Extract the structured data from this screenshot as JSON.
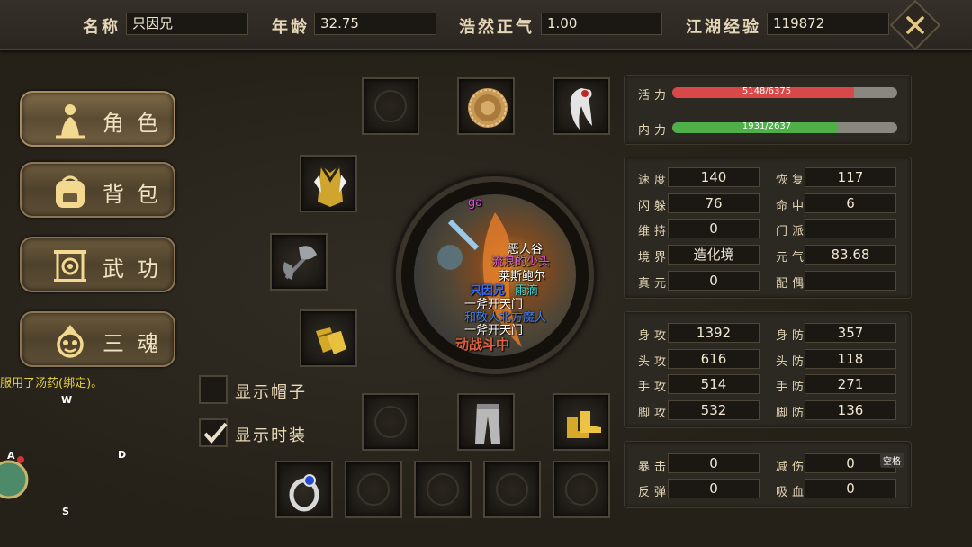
{
  "header": {
    "name_label": "名称",
    "name_value": "只因兄",
    "age_label": "年龄",
    "age_value": "32.75",
    "virtue_label": "浩然正气",
    "virtue_value": "1.00",
    "exp_label": "江湖经验",
    "exp_value": "119872"
  },
  "sidebar": [
    {
      "label": "角色",
      "icon": "character-icon"
    },
    {
      "label": "背包",
      "icon": "backpack-icon"
    },
    {
      "label": "武功",
      "icon": "scroll-icon"
    },
    {
      "label": "三魂",
      "icon": "soul-icon"
    }
  ],
  "chat_log": "服用了汤药(绑定)。",
  "joystick": {
    "w": "W",
    "a": "A",
    "s": "S",
    "d": "D"
  },
  "options": {
    "show_hat": "显示帽子",
    "show_fashion": "显示时装",
    "show_hat_checked": false,
    "show_fashion_checked": true
  },
  "portrait_text": {
    "line1": "恶人谷",
    "line2": "流浪的少头",
    "line3": "莱斯鲍尔",
    "line4a": "只因兄",
    "line4b": "雨滴",
    "line5": "一斧开天门",
    "line6": "和敬人北方魔人",
    "line7": "一斧开天门",
    "line8": "动战斗中",
    "line0": "ga"
  },
  "vitals": {
    "hp_label": "活力",
    "hp_text": "5148/6375",
    "hp_ratio": 0.8075,
    "mp_label": "内力",
    "mp_text": "1931/2637",
    "mp_ratio": 0.7323
  },
  "attributes": {
    "speed_label": "速度",
    "speed": "140",
    "recover_label": "恢复",
    "recover": "117",
    "dodge_label": "闪躲",
    "dodge": "76",
    "hit_label": "命中",
    "hit": "6",
    "sustain_label": "维持",
    "sustain": "0",
    "sect_label": "门派",
    "sect": "",
    "realm_label": "境界",
    "realm": "造化境",
    "yuanqi_label": "元气",
    "yuanqi": "83.68",
    "zhenyuan_label": "真元",
    "zhenyuan": "0",
    "spouse_label": "配偶",
    "spouse": ""
  },
  "combat": {
    "body_atk_label": "身攻",
    "body_atk": "1392",
    "body_def_label": "身防",
    "body_def": "357",
    "head_atk_label": "头攻",
    "head_atk": "616",
    "head_def_label": "头防",
    "head_def": "118",
    "hand_atk_label": "手攻",
    "hand_atk": "514",
    "hand_def_label": "手防",
    "hand_def": "271",
    "foot_atk_label": "脚攻",
    "foot_atk": "532",
    "foot_def_label": "脚防",
    "foot_def": "136"
  },
  "special": {
    "crit_label": "暴击",
    "crit": "0",
    "reduce_label": "减伤",
    "reduce": "0",
    "reflect_label": "反弹",
    "reflect": "0",
    "leech_label": "吸血",
    "leech": "0",
    "space_tag": "空格"
  },
  "colors": {
    "hp": "#d84848",
    "mp": "#4fb04a",
    "gold": "#e0b030",
    "panel": "#2c2822"
  }
}
